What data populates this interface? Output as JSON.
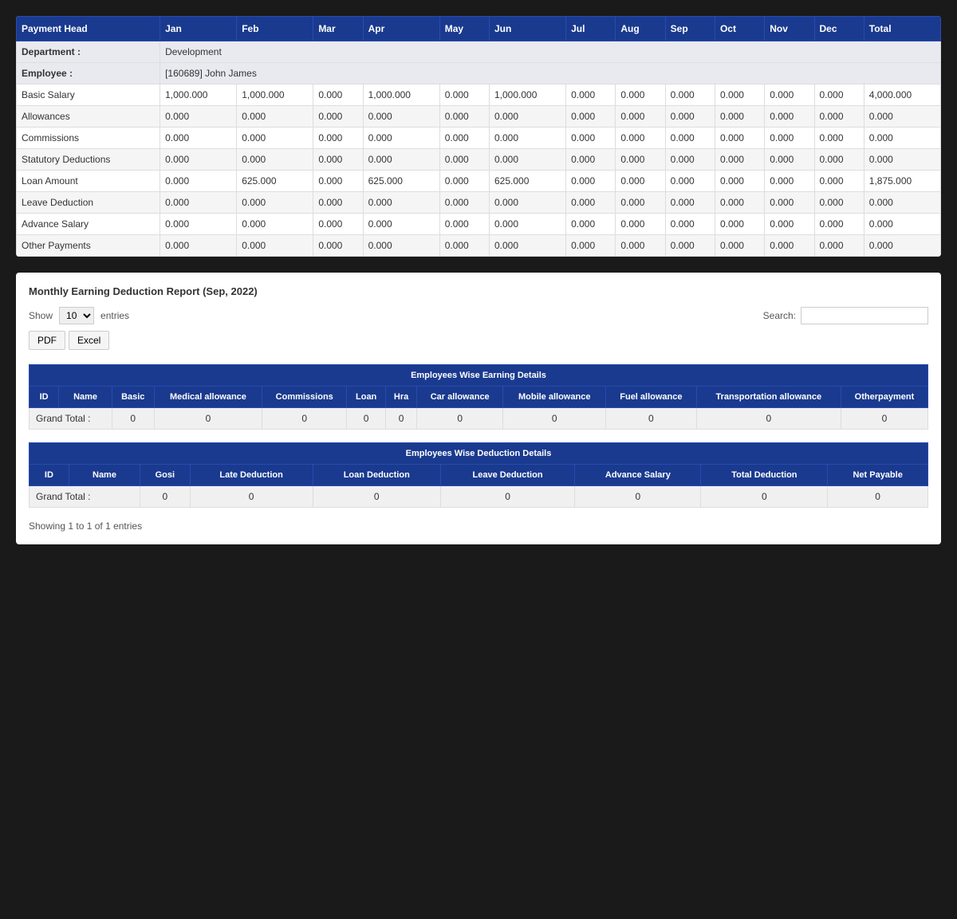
{
  "topTable": {
    "headers": [
      "Payment Head",
      "Jan",
      "Feb",
      "Mar",
      "Apr",
      "May",
      "Jun",
      "Jul",
      "Aug",
      "Sep",
      "Oct",
      "Nov",
      "Dec",
      "Total"
    ],
    "department": {
      "label": "Department :",
      "value": "Development"
    },
    "employee": {
      "label": "Employee :",
      "value": "[160689] John James"
    },
    "rows": [
      {
        "label": "Basic Salary",
        "values": [
          "1,000.000",
          "1,000.000",
          "0.000",
          "1,000.000",
          "0.000",
          "1,000.000",
          "0.000",
          "0.000",
          "0.000",
          "0.000",
          "0.000",
          "0.000",
          "4,000.000"
        ]
      },
      {
        "label": "Allowances",
        "values": [
          "0.000",
          "0.000",
          "0.000",
          "0.000",
          "0.000",
          "0.000",
          "0.000",
          "0.000",
          "0.000",
          "0.000",
          "0.000",
          "0.000",
          "0.000"
        ]
      },
      {
        "label": "Commissions",
        "values": [
          "0.000",
          "0.000",
          "0.000",
          "0.000",
          "0.000",
          "0.000",
          "0.000",
          "0.000",
          "0.000",
          "0.000",
          "0.000",
          "0.000",
          "0.000"
        ]
      },
      {
        "label": "Statutory Deductions",
        "values": [
          "0.000",
          "0.000",
          "0.000",
          "0.000",
          "0.000",
          "0.000",
          "0.000",
          "0.000",
          "0.000",
          "0.000",
          "0.000",
          "0.000",
          "0.000"
        ]
      },
      {
        "label": "Loan Amount",
        "values": [
          "0.000",
          "625.000",
          "0.000",
          "625.000",
          "0.000",
          "625.000",
          "0.000",
          "0.000",
          "0.000",
          "0.000",
          "0.000",
          "0.000",
          "1,875.000"
        ]
      },
      {
        "label": "Leave Deduction",
        "values": [
          "0.000",
          "0.000",
          "0.000",
          "0.000",
          "0.000",
          "0.000",
          "0.000",
          "0.000",
          "0.000",
          "0.000",
          "0.000",
          "0.000",
          "0.000"
        ]
      },
      {
        "label": "Advance Salary",
        "values": [
          "0.000",
          "0.000",
          "0.000",
          "0.000",
          "0.000",
          "0.000",
          "0.000",
          "0.000",
          "0.000",
          "0.000",
          "0.000",
          "0.000",
          "0.000"
        ]
      },
      {
        "label": "Other Payments",
        "values": [
          "0.000",
          "0.000",
          "0.000",
          "0.000",
          "0.000",
          "0.000",
          "0.000",
          "0.000",
          "0.000",
          "0.000",
          "0.000",
          "0.000",
          "0.000"
        ]
      }
    ]
  },
  "bottomSection": {
    "reportTitle": "Monthly Earning Deduction Report (Sep, 2022)",
    "showLabel": "Show",
    "showValue": "10",
    "entriesLabel": "entries",
    "pdfLabel": "PDF",
    "excelLabel": "Excel",
    "searchLabel": "Search:",
    "searchPlaceholder": "",
    "earningTable": {
      "sectionHeader": "Employees Wise Earning Details",
      "columns": [
        "ID",
        "Name",
        "Basic",
        "Medical allowance",
        "Commissions",
        "Loan",
        "Hra",
        "Car allowance",
        "Mobile allowance",
        "Fuel allowance",
        "Transportation allowance",
        "Otherpayment"
      ],
      "grandTotalLabel": "Grand Total :",
      "grandTotalValues": [
        "",
        "0",
        "0",
        "0",
        "0",
        "0",
        "0",
        "0",
        "0",
        "0",
        "0"
      ]
    },
    "deductionTable": {
      "sectionHeader": "Employees Wise Deduction Details",
      "columns": [
        "ID",
        "Name",
        "Gosi",
        "Late Deduction",
        "Loan Deduction",
        "Leave Deduction",
        "Advance Salary",
        "Total Deduction",
        "Net Payable"
      ],
      "grandTotalLabel": "Grand Total :",
      "grandTotalValues": [
        "",
        "0",
        "0",
        "0",
        "0",
        "0",
        "0",
        "0"
      ]
    },
    "showingText": "Showing 1 to 1 of 1 entries"
  }
}
